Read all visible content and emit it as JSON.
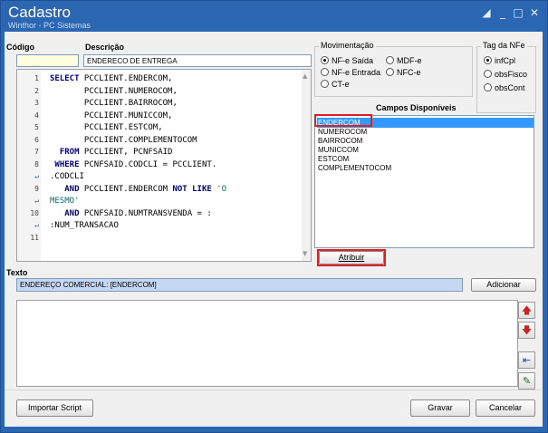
{
  "window": {
    "title": "Cadastro",
    "subtitle": "Winthor - PC Sistemas",
    "controls": [
      "restore-icon",
      "minimize-icon",
      "maximize-icon",
      "close-icon"
    ]
  },
  "fields": {
    "codigo_label": "Código",
    "codigo_value": "",
    "descricao_label": "Descrição",
    "descricao_value": "ENDERECO DE ENTREGA"
  },
  "code_editor": {
    "lines": [
      {
        "n": "1",
        "segments": [
          [
            "kw",
            "SELECT"
          ],
          [
            "op",
            " PCCLIENT.ENDERCOM,"
          ]
        ]
      },
      {
        "n": "2",
        "segments": [
          [
            "op",
            "       PCCLIENT.NUMEROCOM,"
          ]
        ]
      },
      {
        "n": "3",
        "segments": [
          [
            "op",
            "       PCCLIENT.BAIRROCOM,"
          ]
        ]
      },
      {
        "n": "4",
        "segments": [
          [
            "op",
            "       PCCLIENT.MUNICCOM,"
          ]
        ]
      },
      {
        "n": "5",
        "segments": [
          [
            "op",
            "       PCCLIENT.ESTCOM,"
          ]
        ]
      },
      {
        "n": "6",
        "segments": [
          [
            "op",
            "       PCCLIENT.COMPLEMENTOCOM"
          ]
        ]
      },
      {
        "n": "7",
        "segments": [
          [
            "kw",
            "  FROM"
          ],
          [
            "op",
            " PCCLIENT, PCNFSAID"
          ]
        ]
      },
      {
        "n": "8",
        "segments": [
          [
            "kw",
            " WHERE"
          ],
          [
            "op",
            " PCNFSAID.CODCLI = PCCLIENT."
          ]
        ]
      },
      {
        "n": "wrap",
        "segments": [
          [
            "op",
            ".CODCLI"
          ]
        ]
      },
      {
        "n": "9",
        "segments": [
          [
            "kw",
            "   AND"
          ],
          [
            "op",
            " PCCLIENT.ENDERCOM "
          ],
          [
            "kw",
            "NOT LIKE"
          ],
          [
            "str",
            " 'O"
          ]
        ]
      },
      {
        "n": "wrap",
        "segments": [
          [
            "str",
            "MESMO'"
          ]
        ]
      },
      {
        "n": "10",
        "segments": [
          [
            "kw",
            "   AND"
          ],
          [
            "op",
            " PCNFSAID.NUMTRANSVENDA = :"
          ]
        ]
      },
      {
        "n": "wrap",
        "segments": [
          [
            "op",
            ":NUM_TRANSACAO"
          ]
        ]
      },
      {
        "n": "11",
        "segments": []
      }
    ]
  },
  "movimentacao": {
    "title": "Movimentação",
    "options": [
      {
        "label": "NF-e Saída",
        "checked": true
      },
      {
        "label": "MDF-e",
        "checked": false
      },
      {
        "label": "NF-e Entrada",
        "checked": false
      },
      {
        "label": "NFC-e",
        "checked": false
      },
      {
        "label": "CT-e",
        "checked": false
      }
    ]
  },
  "tag_nfe": {
    "title": "Tag da NFe",
    "options": [
      {
        "label": "infCpl",
        "checked": true
      },
      {
        "label": "obsFisco",
        "checked": false
      },
      {
        "label": "obsCont",
        "checked": false
      }
    ]
  },
  "campos": {
    "title": "Campos Disponíveis",
    "items": [
      "ENDERCOM",
      "NUMEROCOM",
      "BAIRROCOM",
      "MUNICCOM",
      "ESTCOM",
      "COMPLEMENTOCOM"
    ],
    "selected_index": 0
  },
  "buttons": {
    "atribuir": "Atribuir",
    "adicionar": "Adicionar",
    "importar": "Importar Script",
    "gravar": "Gravar",
    "cancelar": "Cancelar"
  },
  "texto": {
    "label": "Texto",
    "value": "ENDEREÇO COMERCIAL: [ENDERCOM]"
  },
  "colors": {
    "title_bar": "#2b66b3",
    "selection": "#3399ff",
    "highlight_border": "#e02020",
    "texto_field": "#c5d7f2"
  }
}
